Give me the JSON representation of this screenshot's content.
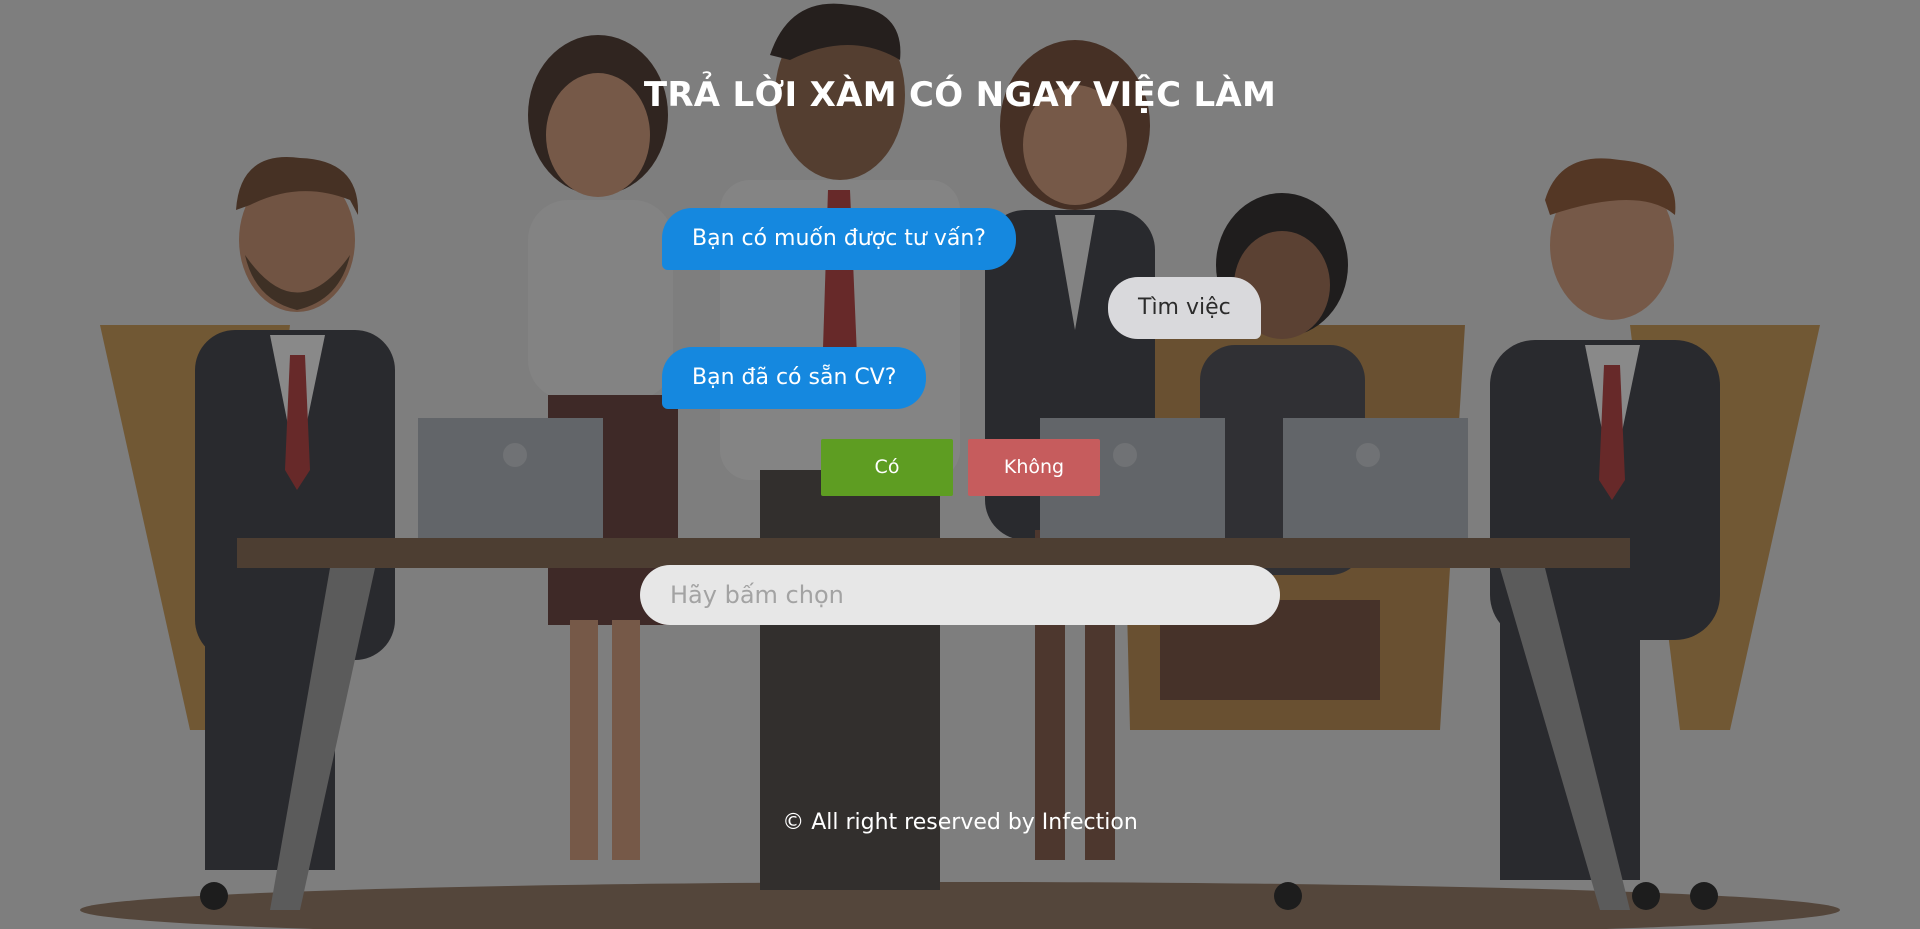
{
  "page": {
    "title": "TRẢ LỜI XÀM CÓ NGAY VIỆC LÀM"
  },
  "chat": {
    "messages": [
      {
        "from": "bot",
        "text": "Bạn có muốn được tư vấn?"
      },
      {
        "from": "user",
        "text": "Tìm việc"
      },
      {
        "from": "bot",
        "text": "Bạn đã có sẵn CV?"
      }
    ],
    "choices": {
      "yes_label": "Có",
      "no_label": "Không"
    },
    "input": {
      "placeholder": "Hãy bấm chọn"
    }
  },
  "footer": {
    "text": "© All right reserved by Infection"
  },
  "colors": {
    "bot_bubble": "#1588df",
    "user_bubble": "#d9d9dc",
    "yes_button": "#5e9d22",
    "no_button": "#c65c5d",
    "overlay": "#3f3f3f"
  }
}
